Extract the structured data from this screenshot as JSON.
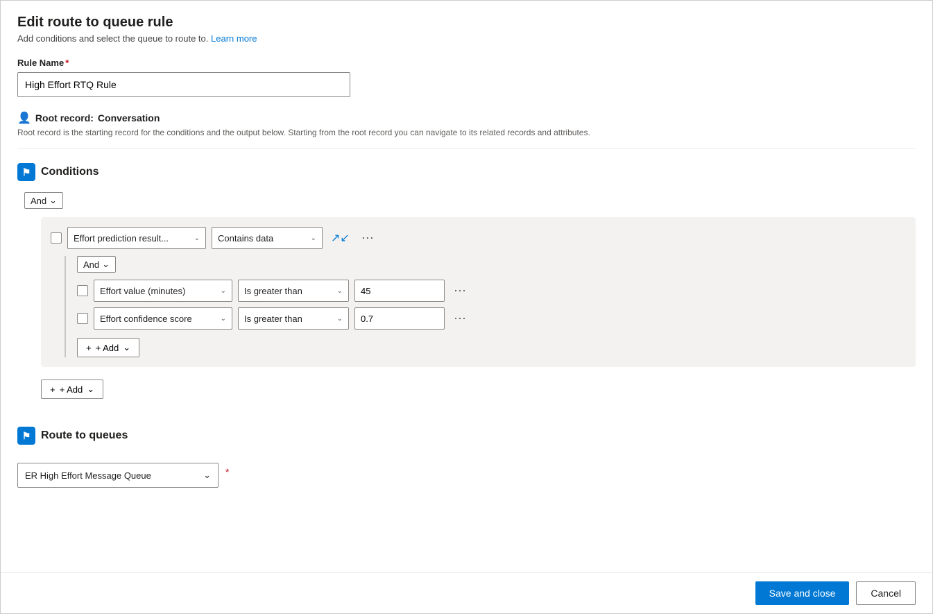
{
  "page": {
    "title": "Edit route to queue rule",
    "subtitle": "Add conditions and select the queue to route to.",
    "learn_more": "Learn more",
    "rule_name_label": "Rule Name",
    "rule_name_value": "High Effort RTQ Rule",
    "rule_name_placeholder": "High Effort RTQ Rule",
    "root_record_label": "Root record:",
    "root_record_value": "Conversation",
    "root_record_desc": "Root record is the starting record for the conditions and the output below. Starting from the root record you can navigate to its related records and attributes.",
    "conditions_title": "Conditions",
    "and_label": "And",
    "add_label": "+ Add",
    "condition1": {
      "field": "Effort prediction result...",
      "operator": "Contains data"
    },
    "sub_condition1": {
      "field": "Effort value (minutes)",
      "operator": "Is greater than",
      "value": "45"
    },
    "sub_condition2": {
      "field": "Effort confidence score",
      "operator": "Is greater than",
      "value": "0.7"
    },
    "route_to_queues_title": "Route to queues",
    "queue_value": "ER High Effort Message Queue",
    "save_close_label": "Save and close",
    "cancel_label": "Cancel"
  }
}
